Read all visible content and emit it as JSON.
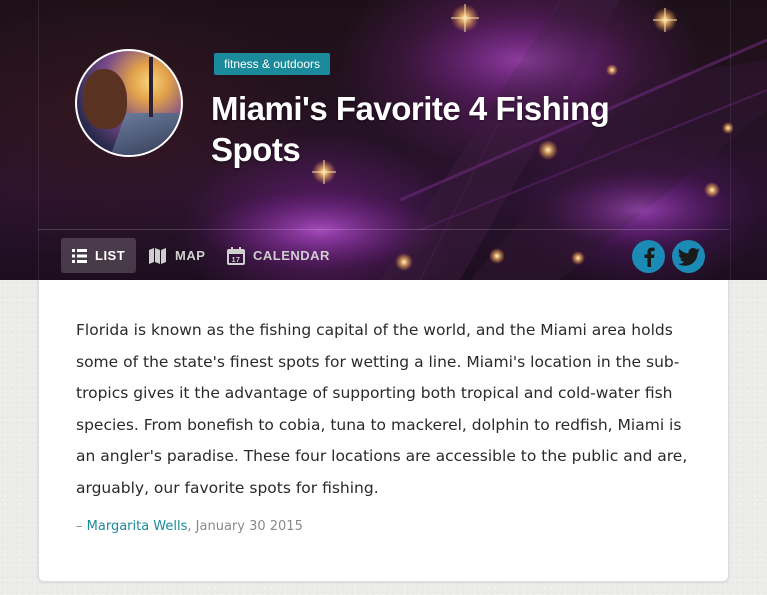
{
  "article": {
    "category": "fitness & outdoors",
    "title": "Miami's Favorite 4 Fishing Spots",
    "intro": "Florida is known as the fishing capital of the world, and the Miami area holds some of the state's finest spots for wetting a line. Miami's location in the sub-tropics gives it the advantage of supporting both tropical and cold-water fish species. From bonefish to cobia, tuna to mackerel, dolphin to redfish, Miami is an angler's paradise. These four locations are accessible to the public and are, arguably, our favorite spots for fishing.",
    "byline_prefix": "– ",
    "author": "Margarita Wells",
    "byline_separator": ", ",
    "date": "January 30 2015"
  },
  "tabs": [
    {
      "label": "LIST",
      "icon": "list-icon",
      "active": true
    },
    {
      "label": "MAP",
      "icon": "map-icon",
      "active": false
    },
    {
      "label": "CALENDAR",
      "icon": "calendar-icon",
      "active": false
    }
  ],
  "calendar_icon_day": "17",
  "share": [
    {
      "icon": "facebook-icon"
    },
    {
      "icon": "twitter-icon"
    }
  ],
  "colors": {
    "accent": "#1b8a9a",
    "share_button": "#1b8ab4",
    "hero_background": "#241222"
  }
}
